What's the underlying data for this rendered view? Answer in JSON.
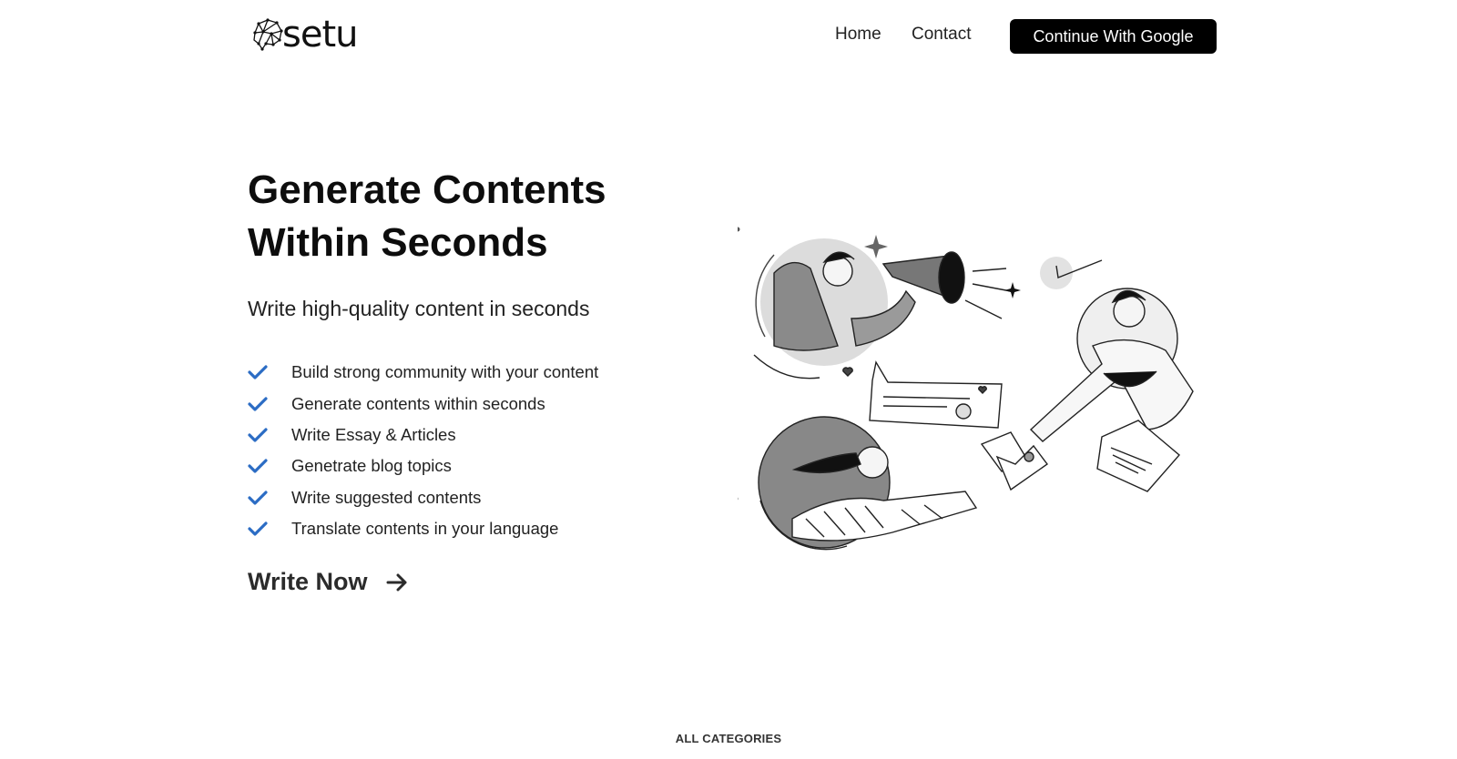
{
  "header": {
    "logo_text": "setu",
    "nav": {
      "home": "Home",
      "contact": "Contact"
    },
    "cta_label": "Continue With Google"
  },
  "hero": {
    "title": "Generate Contents Within Seconds",
    "subtitle": "Write high-quality content in seconds",
    "features": [
      "Build strong community with your content",
      "Generate contents within seconds",
      "Write Essay & Articles",
      "Genetrate blog topics",
      "Write suggested contents",
      "Translate contents in your language"
    ],
    "write_now_label": "Write Now"
  },
  "sections": {
    "all_categories_label": "ALL CATEGORIES"
  },
  "icons": {
    "logo": "brain-network-icon",
    "feature_bullet": "check-icon",
    "write_now": "arrow-right-icon"
  },
  "colors": {
    "accent": "#2b6cc4",
    "button_bg": "#000000",
    "text": "#111111"
  }
}
